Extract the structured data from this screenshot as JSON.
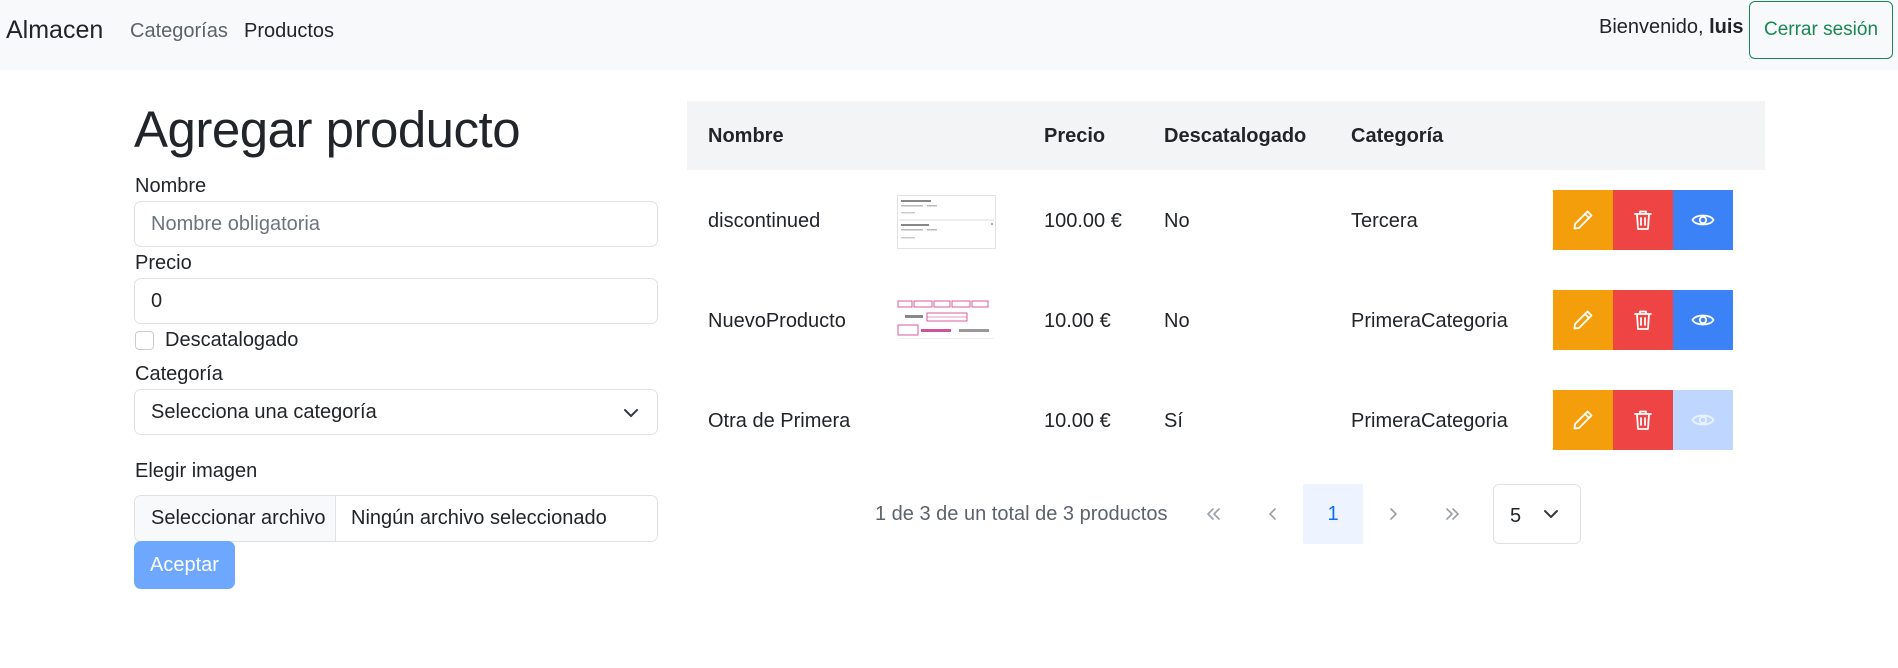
{
  "navbar": {
    "brand": "Almacen",
    "links": [
      {
        "label": "Categorías"
      },
      {
        "label": "Productos"
      }
    ],
    "welcome_prefix": "Bienvenido,",
    "username": "luis",
    "logout_label": "Cerrar sesión"
  },
  "form": {
    "title": "Agregar producto",
    "name_label": "Nombre",
    "name_placeholder": "Nombre obligatoria",
    "price_label": "Precio",
    "price_value": "0",
    "discontinued_label": "Descatalogado",
    "discontinued_checked": false,
    "category_label": "Categoría",
    "category_selected": "Selecciona una categoría",
    "image_label": "Elegir imagen",
    "file_button": "Seleccionar archivo",
    "file_status": "Ningún archivo seleccionado",
    "submit_label": "Aceptar"
  },
  "table": {
    "columns": [
      "Nombre",
      "Precio",
      "Descatalogado",
      "Categoría"
    ],
    "rows": [
      {
        "name": "discontinued",
        "price": "100.00 €",
        "discontinued": "No",
        "category": "Tercera",
        "has_image": true,
        "view_enabled": true
      },
      {
        "name": "NuevoProducto",
        "price": "10.00 €",
        "discontinued": "No",
        "category": "PrimeraCategoria",
        "has_image": true,
        "view_enabled": true
      },
      {
        "name": "Otra de Primera",
        "price": "10.00 €",
        "discontinued": "Sí",
        "category": "PrimeraCategoria",
        "has_image": false,
        "view_enabled": false
      }
    ]
  },
  "pagination": {
    "summary": "1 de 3 de un total de 3 productos",
    "current_page": "1",
    "page_size": "5"
  },
  "colors": {
    "edit": "#f59e0b",
    "delete": "#ef4444",
    "view": "#3b82f6",
    "view_disabled": "#bfd7fe",
    "logout": "#198754",
    "submit": "#6ea8fe"
  },
  "icons": {
    "edit": "pencil-icon",
    "delete": "trash-icon",
    "view": "eye-icon",
    "first": "chevrons-left-icon",
    "prev": "chevron-left-icon",
    "next": "chevron-right-icon",
    "last": "chevrons-right-icon",
    "select": "chevron-down-icon"
  }
}
